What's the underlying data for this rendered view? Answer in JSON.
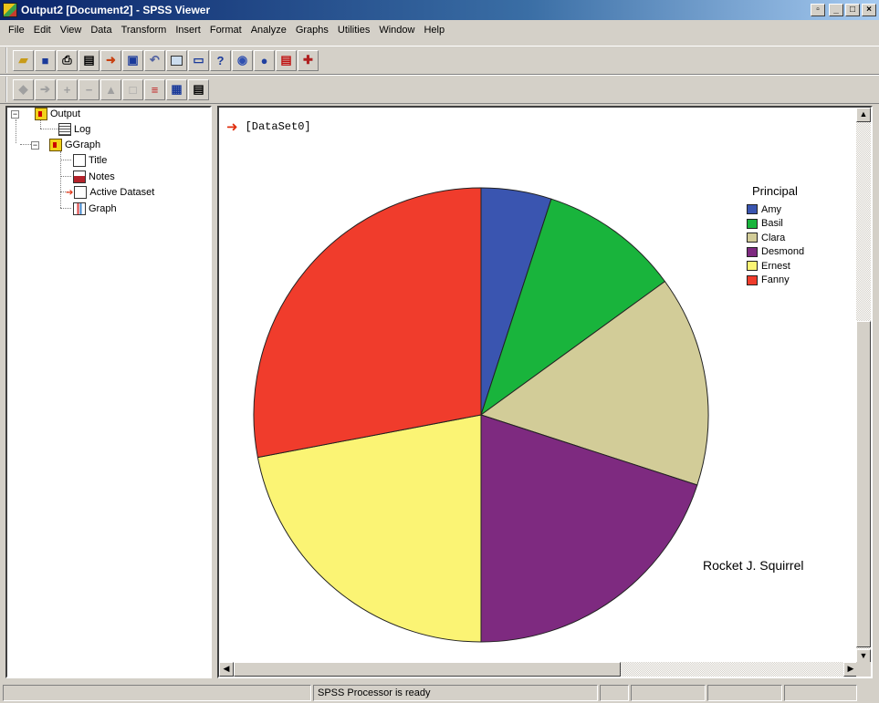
{
  "window": {
    "title": "Output2 [Document2] - SPSS Viewer",
    "buttons": [
      "▫",
      "_",
      "□",
      "×"
    ]
  },
  "menu": [
    "File",
    "Edit",
    "View",
    "Data",
    "Transform",
    "Insert",
    "Format",
    "Analyze",
    "Graphs",
    "Utilities",
    "Window",
    "Help"
  ],
  "outline": {
    "items": [
      {
        "label": "Output",
        "icon": "output-book-icon",
        "expand": "−"
      },
      {
        "label": "Log",
        "icon": "log-icon"
      },
      {
        "label": "GGraph",
        "icon": "ggraph-book-icon",
        "expand": "−"
      },
      {
        "label": "Title",
        "icon": "title-doc-icon"
      },
      {
        "label": "Notes",
        "icon": "notes-icon"
      },
      {
        "label": "Active Dataset",
        "icon": "active-dataset-icon"
      },
      {
        "label": "Graph",
        "icon": "graph-icon"
      }
    ]
  },
  "content": {
    "dataset_label": "[DataSet0]"
  },
  "chart_data": {
    "type": "pie",
    "legend_title": "Principal",
    "legend_position": "top-right",
    "categories": [
      "Amy",
      "Basil",
      "Clara",
      "Desmond",
      "Ernest",
      "Fanny"
    ],
    "values": [
      5,
      10,
      15,
      20,
      22,
      28
    ],
    "colors": [
      "#3a55b0",
      "#19b43c",
      "#d2cc98",
      "#7e2a80",
      "#fbf474",
      "#f03c2c"
    ],
    "annotation": "Rocket J. Squirrel"
  },
  "status": {
    "text": "SPSS Processor is ready"
  }
}
